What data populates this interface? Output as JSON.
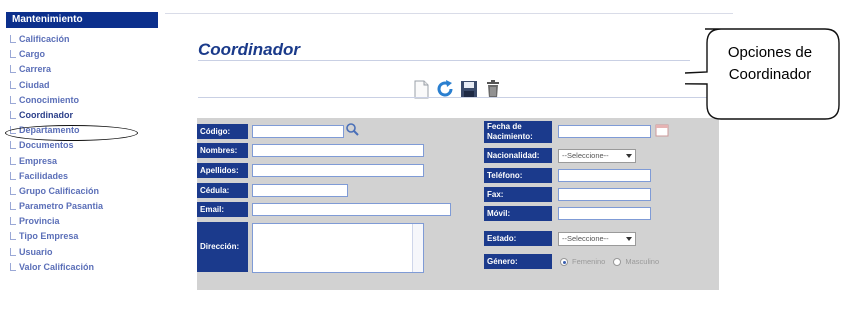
{
  "sidebar": {
    "header": "Mantenimiento",
    "items": [
      {
        "label": "Calificación"
      },
      {
        "label": "Cargo"
      },
      {
        "label": "Carrera"
      },
      {
        "label": "Ciudad"
      },
      {
        "label": "Conocimiento"
      },
      {
        "label": "Coordinador",
        "active": true
      },
      {
        "label": "Departamento"
      },
      {
        "label": "Documentos"
      },
      {
        "label": "Empresa"
      },
      {
        "label": "Facilidades"
      },
      {
        "label": "Grupo Calificación"
      },
      {
        "label": "Parametro Pasantia"
      },
      {
        "label": "Provincia"
      },
      {
        "label": "Tipo Empresa"
      },
      {
        "label": "Usuario"
      },
      {
        "label": "Valor Calificación"
      }
    ]
  },
  "main": {
    "title": "Coordinador",
    "toolbar": {
      "buttons": [
        {
          "icon": "new-document-icon"
        },
        {
          "icon": "refresh-icon"
        },
        {
          "icon": "save-icon"
        },
        {
          "icon": "trash-icon"
        }
      ]
    }
  },
  "form": {
    "codigo_label": "Código:",
    "nombres_label": "Nombres:",
    "apellidos_label": "Apellidos:",
    "cedula_label": "Cédula:",
    "email_label": "Email:",
    "direccion_label": "Dirección:",
    "fecha_label": "Fecha de Nacimiento:",
    "nacionalidad_label": "Nacionalidad:",
    "nacionalidad_value": "--Seleccione--",
    "telefono_label": "Teléfono:",
    "fax_label": "Fax:",
    "movil_label": "Móvil:",
    "estado_label": "Estado:",
    "estado_value": "--Seleccione--",
    "genero_label": "Género:",
    "genero_options": [
      "Femenino",
      "Masculino"
    ],
    "genero_selected": "Femenino"
  },
  "callout": {
    "line1": "Opciones de",
    "line2": "Coordinador"
  },
  "colors": {
    "label_bg": "#1b3a8c",
    "sidebar_header_bg": "#0b2f8c",
    "sidebar_link": "#5b6fb8",
    "form_bg": "#d2d2d2"
  }
}
